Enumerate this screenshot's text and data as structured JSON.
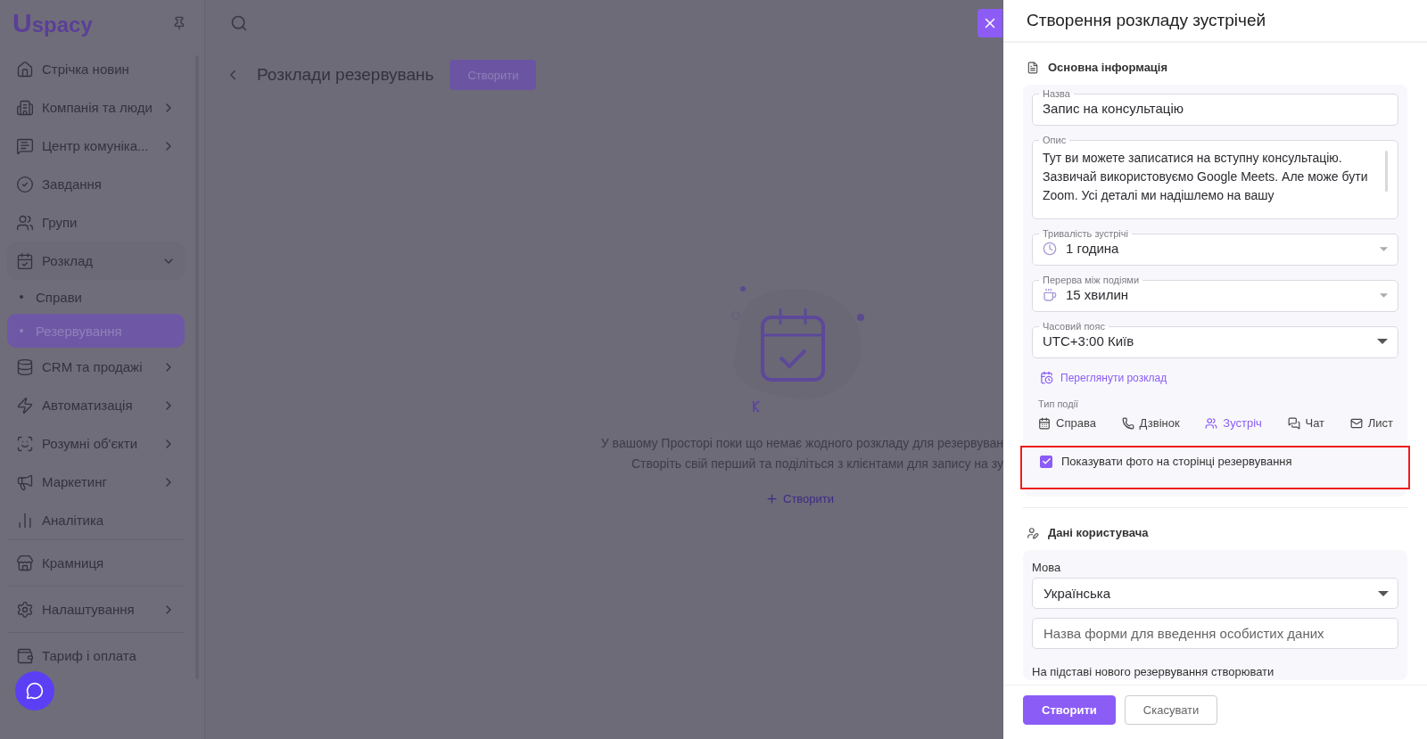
{
  "logo": {
    "mark": "U",
    "text": "spacy"
  },
  "sidebar": {
    "groups": [
      [
        {
          "label": "Стрічка новин",
          "expandable": false,
          "selected": false
        },
        {
          "label": "Компанія та люди",
          "expandable": true,
          "selected": false
        },
        {
          "label": "Центр комуніка...",
          "expandable": true,
          "selected": false
        },
        {
          "label": "Завдання",
          "expandable": false,
          "selected": false
        },
        {
          "label": "Групи",
          "expandable": false,
          "selected": false
        },
        {
          "label": "Розклад",
          "expandable": true,
          "expanded": true,
          "selected": false,
          "children": [
            {
              "label": "Справи",
              "selected": false
            },
            {
              "label": "Резервування",
              "selected": true
            }
          ]
        },
        {
          "label": "CRM та продажі",
          "expandable": true,
          "selected": false
        },
        {
          "label": "Автоматизація",
          "expandable": true,
          "selected": false
        },
        {
          "label": "Розумні об'єкти",
          "expandable": true,
          "selected": false
        },
        {
          "label": "Маркетинг",
          "expandable": true,
          "selected": false
        },
        {
          "label": "Аналітика",
          "expandable": false,
          "selected": false
        }
      ],
      [
        {
          "label": "Крамниця",
          "expandable": false,
          "selected": false
        }
      ],
      [
        {
          "label": "Налаштування",
          "expandable": true,
          "selected": false
        }
      ],
      [
        {
          "label": "Тариф і оплата",
          "expandable": false,
          "selected": false
        }
      ]
    ]
  },
  "page": {
    "title": "Розклади резервувань",
    "create_button": "Створити",
    "empty_state": {
      "lines": [
        "У вашому Просторі поки що немає жодного розкладу для резервуван",
        "Створіть свій перший та поділіться з клієнтами для запису на зу"
      ],
      "link": "Створити"
    }
  },
  "drawer": {
    "title": "Створення розкладу зустрічей",
    "sections": [
      {
        "title": "Основна інформація"
      },
      {
        "title": "Дані користувача"
      }
    ],
    "fields": [
      {
        "kind": "input",
        "label": "Назва",
        "value": "Запис на консультацію"
      },
      {
        "kind": "textarea",
        "label": "Опис",
        "value": "Тут ви можете записатися на вступну консультацію. Зазвичай використовуємо Google Meets. Але може бути Zoom. Усі деталі ми надішлемо на вашу"
      },
      {
        "kind": "select",
        "label": "Тривалість зустрічі",
        "value": "1 година"
      },
      {
        "kind": "select",
        "label": "Перерва між подіями",
        "value": "15 хвилин"
      },
      {
        "kind": "select",
        "label": "Часовий пояс",
        "value": "UTC+3:00 Київ"
      }
    ],
    "schedule_link": "Переглянути розклад",
    "event_type": {
      "label": "Тип події",
      "options": [
        {
          "label": "Справа",
          "selected": false
        },
        {
          "label": "Дзвінок",
          "selected": false
        },
        {
          "label": "Зустріч",
          "selected": true
        },
        {
          "label": "Чат",
          "selected": false
        },
        {
          "label": "Лист",
          "selected": false
        }
      ]
    },
    "show_photo": {
      "label": "Показувати фото на сторінці резервування",
      "checked": true,
      "highlighted": true
    },
    "user_data": {
      "language_label": "Мова",
      "language": "Українська",
      "form_name": {
        "placeholder": "Назва форми для введення особистих даних"
      },
      "create_on_label": "На підставі нового резервування створювати"
    },
    "buttons": [
      {
        "label": "Створити",
        "kind": "primary"
      },
      {
        "label": "Скасувати",
        "kind": "secondary"
      }
    ]
  }
}
